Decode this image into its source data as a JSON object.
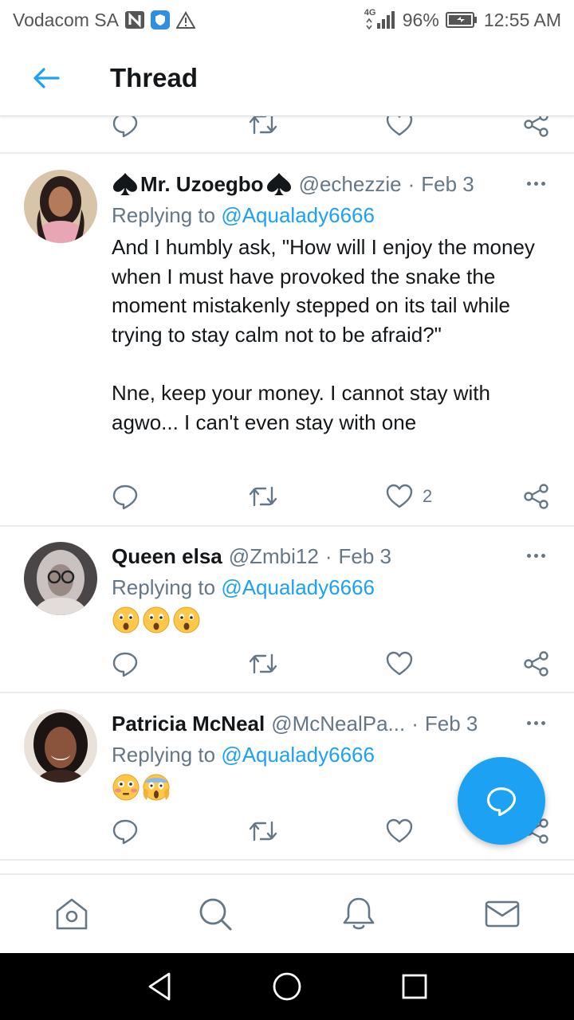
{
  "status_bar": {
    "carrier": "Vodacom SA",
    "network": "4G",
    "battery": "96%",
    "time": "12:55 AM"
  },
  "header": {
    "title": "Thread",
    "back_icon": "arrow-left-icon"
  },
  "tweets": [
    {
      "name": "Mr. Uzoegbo",
      "name_decoration": "spade-suit-icon",
      "handle": "@echezzie",
      "separator": "·",
      "date": "Feb 3",
      "replying_prefix": "Replying to",
      "replying_to": "@Aqualady6666",
      "body": [
        "And I humbly ask, \"How will I enjoy the money when I must have provoked the snake the moment mistakenly stepped on its tail while trying to stay calm not to be afraid?\"",
        "Nne, keep your money. I cannot stay with agwo... I can't even stay with one"
      ],
      "like_count": "2",
      "avatar_color": "#c9a98a"
    },
    {
      "name": "Queen elsa",
      "handle": "@Zmbi12",
      "separator": "·",
      "date": "Feb 3",
      "replying_prefix": "Replying to",
      "replying_to": "@Aqualady6666",
      "emojis": [
        "astonished-face",
        "astonished-face",
        "astonished-face"
      ],
      "avatar_color": "#6c6468"
    },
    {
      "name": "Patricia McNeal",
      "handle": "@McNealPa...",
      "separator": "·",
      "date": "Feb 3",
      "replying_prefix": "Replying to",
      "replying_to": "@Aqualady6666",
      "emojis": [
        "flushed-face",
        "face-screaming-in-fear"
      ],
      "avatar_color": "#7a4a35"
    }
  ],
  "colors": {
    "accent": "#1da1f2",
    "secondary_text": "#657786",
    "primary_text": "#14171a",
    "divider": "#e6ecf0"
  },
  "tab_bar": [
    "home-icon",
    "search-icon",
    "notifications-bell-icon",
    "messages-envelope-icon"
  ],
  "system_nav": [
    "back-triangle-icon",
    "home-circle-icon",
    "recents-square-icon"
  ]
}
